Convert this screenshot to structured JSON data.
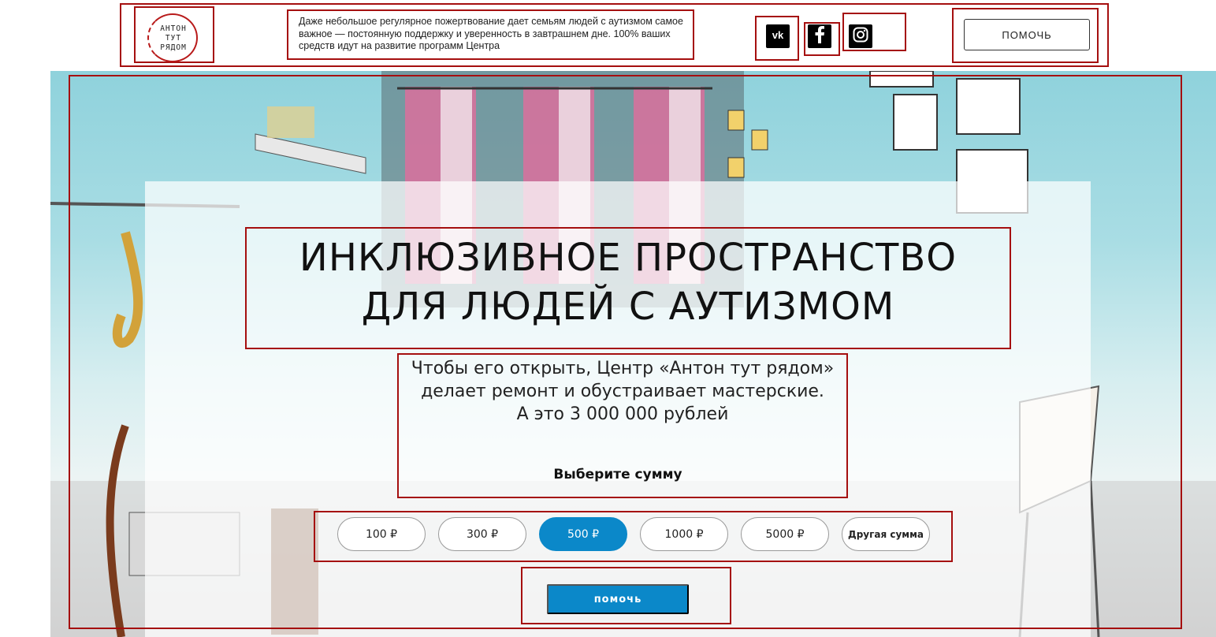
{
  "header": {
    "logo_lines": [
      "АНТОН",
      "ТУТ",
      "РЯДОМ"
    ],
    "intro_text": "Даже небольшое регулярное пожертвование дает семьям людей с аутизмом самое важное — постоянную поддержку и уверенность в завтрашнем дне. 100% ваших средств идут на развитие программ Центра",
    "social": [
      {
        "name": "vk",
        "glyph": "vk"
      },
      {
        "name": "facebook",
        "glyph": "f"
      },
      {
        "name": "instagram",
        "glyph": ""
      }
    ],
    "help_label": "ПОМОЧЬ"
  },
  "hero": {
    "title": "ИНКЛЮЗИВНОЕ ПРОСТРАНСТВО\nДЛЯ ЛЮДЕЙ С АУТИЗМОМ",
    "description": "Чтобы его открыть, Центр «Антон тут рядом»\nделает ремонт и обустраивает мастерские.\nА это 3 000 000 рублей",
    "choose_label": "Выберите сумму",
    "amounts": [
      {
        "label": "100 ₽",
        "selected": false
      },
      {
        "label": "300 ₽",
        "selected": false
      },
      {
        "label": "500 ₽",
        "selected": true
      },
      {
        "label": "1000 ₽",
        "selected": false
      },
      {
        "label": "5000 ₽",
        "selected": false
      },
      {
        "label": "Другая сумма",
        "selected": false
      }
    ],
    "help_label": "помочь"
  },
  "colors": {
    "accent": "#0b88c9",
    "annotation": "#a50f0f"
  }
}
